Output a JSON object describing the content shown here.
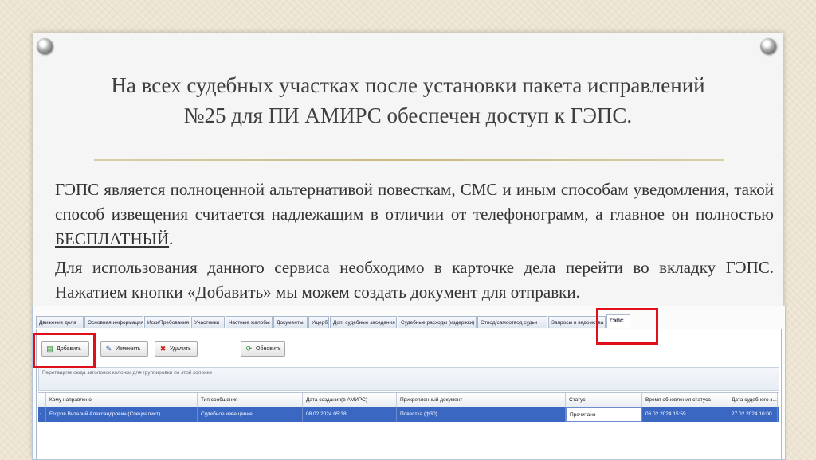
{
  "slide": {
    "title_line1": "На всех судебных участках после установки пакета исправлений",
    "title_line2": "№25 для ПИ АМИРС обеспечен доступ к ГЭПС.",
    "para1_text": "ГЭПС является полноценной альтернативой повесткам, СМС и иным способам уведомления, такой способ извещения считается надлежащим в отличии от телефонограмм, а главное он полностью ",
    "para1_emphasis": "БЕСПЛАТНЫЙ",
    "para1_end": ".",
    "para2_text": "Для использования данного сервиса необходимо в карточке дела перейти во вкладку ГЭПС. Нажатием кнопки «Добавить» мы можем создать документ для отправки."
  },
  "app": {
    "tabs": [
      "Движение дела",
      "Основная информация",
      "Иски/Требования",
      "Участники",
      "Частные жалобы",
      "Документы",
      "Ущерб",
      "Доп. судебные заседания",
      "Судебные расходы (издержки)",
      "Отвод/самоотвод судьи",
      "Запросы в ведомства",
      "ГЭПС"
    ],
    "active_tab": "ГЭПС",
    "toolbar": {
      "add_label": "Добавить",
      "edit_label": "Изменить",
      "delete_label": "Удалить",
      "refresh_label": "Обновить"
    },
    "group_hint": "Перетащите сюда заголовок колонки для группировки по этой колонке",
    "columns": [
      "Кому направлено",
      "Тип сообщения",
      "Дата создания(в АМИРС)",
      "Прикрепленный документ",
      "Статус",
      "Время обновления статуса",
      "Дата судебного з..."
    ],
    "row": {
      "recipient": "Егоров Виталий Александрович (Специалист)",
      "type": "Судебное извещение",
      "created": "08.02.2024 05:38",
      "document": "Повестка (ф30)",
      "status": "Прочитано",
      "updated": "06.02.2024 15:59",
      "court_date": "27.02.2024 10:00"
    },
    "colors": {
      "highlight": "#e0101a",
      "selected_row": "#3a67c2"
    }
  }
}
